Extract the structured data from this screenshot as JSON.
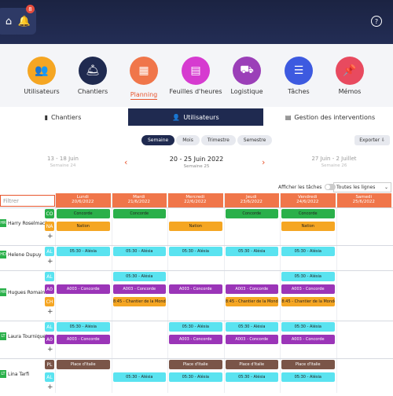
{
  "header": {
    "notification_count": "8",
    "help_glyph": "?"
  },
  "modules": [
    {
      "label": "Utilisateurs",
      "color": "#f5a623",
      "icon": "users-icon",
      "glyph": "👥"
    },
    {
      "label": "Chantiers",
      "color": "#1f2a50",
      "icon": "bell-icon",
      "glyph": "🛎"
    },
    {
      "label": "Planning",
      "color": "#f0764a",
      "icon": "calendar-icon",
      "glyph": "▦"
    },
    {
      "label": "Feuilles d'heures",
      "color": "#d63bd0",
      "icon": "timesheet-icon",
      "glyph": "▤"
    },
    {
      "label": "Logistique",
      "color": "#9b3fb8",
      "icon": "truck-icon",
      "glyph": "⛟"
    },
    {
      "label": "Tâches",
      "color": "#3d5ae0",
      "icon": "tasks-icon",
      "glyph": "☰"
    },
    {
      "label": "Mémos",
      "color": "#e84a5f",
      "icon": "pin-icon",
      "glyph": "📌"
    }
  ],
  "subtabs": [
    {
      "label": "Chantiers",
      "glyph": "▮"
    },
    {
      "label": "Utilisateurs",
      "glyph": "👤"
    },
    {
      "label": "Gestion des interventions",
      "glyph": "▤"
    }
  ],
  "period": [
    "Semaine",
    "Mois",
    "Trimestre",
    "Semestre"
  ],
  "export_label": "Exporter ⇩",
  "weeks": {
    "prev": {
      "range": "13 - 18 Juin",
      "num": "Semaine 24"
    },
    "current": {
      "range": "20 - 25 Juin 2022",
      "num": "Semaine 25"
    },
    "next": {
      "range": "27 Juin - 2 Juillet",
      "num": "Semaine 26"
    }
  },
  "show_tasks_label": "Afficher les tâches",
  "lines_select": "Toutes les lignes",
  "filter_placeholder": "Filtrer",
  "days": [
    {
      "day": "Lundi",
      "date": "20/6/2022"
    },
    {
      "day": "Mardi",
      "date": "21/6/2022"
    },
    {
      "day": "Mercredi",
      "date": "22/6/2022"
    },
    {
      "day": "Jeudi",
      "date": "23/6/2022"
    },
    {
      "day": "Vendredi",
      "date": "24/6/2022"
    },
    {
      "day": "Samedi",
      "date": "25/6/2022"
    }
  ],
  "colors": {
    "green": "#2ab04a",
    "orange": "#f5a623",
    "cyan": "#5ae3f0",
    "purple": "#9b35b8",
    "brown": "#7a5548",
    "accent": "#f0764a"
  },
  "people": [
    {
      "initials": "HR",
      "name": "Harry Roselmack",
      "rows": [
        {
          "tag": "CO",
          "color": "green",
          "bars": [
            {
              "d": 0,
              "t": "Concorde"
            },
            {
              "d": 1,
              "t": "Concorde"
            },
            {
              "d": 3,
              "t": "Concorde"
            },
            {
              "d": 4,
              "t": "Concorde"
            }
          ]
        },
        {
          "tag": "NA",
          "color": "orange",
          "bars": [
            {
              "d": 0,
              "t": "Nation"
            },
            {
              "d": 2,
              "t": "Nation"
            },
            {
              "d": 4,
              "t": "Nation"
            }
          ]
        }
      ]
    },
    {
      "initials": "HD",
      "name": "Helene Dupuy",
      "rows": [
        {
          "tag": "AL",
          "color": "cyan",
          "bars": [
            {
              "d": 0,
              "t": "05:30 - Alésia"
            },
            {
              "d": 1,
              "t": "05:30 - Alésia"
            },
            {
              "d": 2,
              "t": "05:30 - Alésia"
            },
            {
              "d": 3,
              "t": "05:30 - Alésia"
            },
            {
              "d": 4,
              "t": "05:30 - Alésia"
            }
          ]
        }
      ]
    },
    {
      "initials": "HR",
      "name": "Hugues Romain",
      "rows": [
        {
          "tag": "AL",
          "color": "cyan",
          "bars": [
            {
              "d": 1,
              "t": "05:30 - Alésia"
            },
            {
              "d": 4,
              "t": "05:30 - Alésia"
            }
          ]
        },
        {
          "tag": "A0",
          "color": "purple",
          "bars": [
            {
              "d": 0,
              "t": "A003 - Concorde"
            },
            {
              "d": 1,
              "t": "A003 - Concorde"
            },
            {
              "d": 2,
              "t": "A003 - Concorde"
            },
            {
              "d": 3,
              "t": "A003 - Concorde"
            },
            {
              "d": 4,
              "t": "A003 - Concorde"
            }
          ]
        },
        {
          "tag": "CH",
          "color": "orange",
          "bars": [
            {
              "d": 1,
              "t": "18:45 - Chantier de la Monde"
            },
            {
              "d": 3,
              "t": "18:45 - Chantier de la Monde"
            },
            {
              "d": 4,
              "t": "18:45 - Chantier de la Monde"
            }
          ]
        }
      ]
    },
    {
      "initials": "LT",
      "name": "Laura Tourniquet",
      "rows": [
        {
          "tag": "AL",
          "color": "cyan",
          "bars": [
            {
              "d": 0,
              "t": "05:30 - Alésia"
            },
            {
              "d": 2,
              "t": "05:30 - Alésia"
            },
            {
              "d": 3,
              "t": "05:30 - Alésia"
            },
            {
              "d": 4,
              "t": "05:30 - Alésia"
            }
          ]
        },
        {
          "tag": "A0",
          "color": "purple",
          "bars": [
            {
              "d": 0,
              "t": "A003 - Concorde"
            },
            {
              "d": 2,
              "t": "A003 - Concorde"
            },
            {
              "d": 3,
              "t": "A003 - Concorde"
            },
            {
              "d": 4,
              "t": "A003 - Concorde"
            }
          ]
        }
      ]
    },
    {
      "initials": "LT",
      "name": "Lina Tarfi",
      "rows": [
        {
          "tag": "PL",
          "color": "brown",
          "bars": [
            {
              "d": 0,
              "t": "Place d'Italie"
            },
            {
              "d": 2,
              "t": "Place d'Italie"
            },
            {
              "d": 3,
              "t": "Place d'Italie"
            },
            {
              "d": 4,
              "t": "Place d'Italie"
            }
          ]
        },
        {
          "tag": "AL",
          "color": "cyan",
          "bars": [
            {
              "d": 1,
              "t": "05:30 - Alésia"
            },
            {
              "d": 2,
              "t": "05:30 - Alésia"
            },
            {
              "d": 3,
              "t": "05:30 - Alésia"
            },
            {
              "d": 4,
              "t": "05:30 - Alésia"
            }
          ]
        }
      ]
    }
  ]
}
